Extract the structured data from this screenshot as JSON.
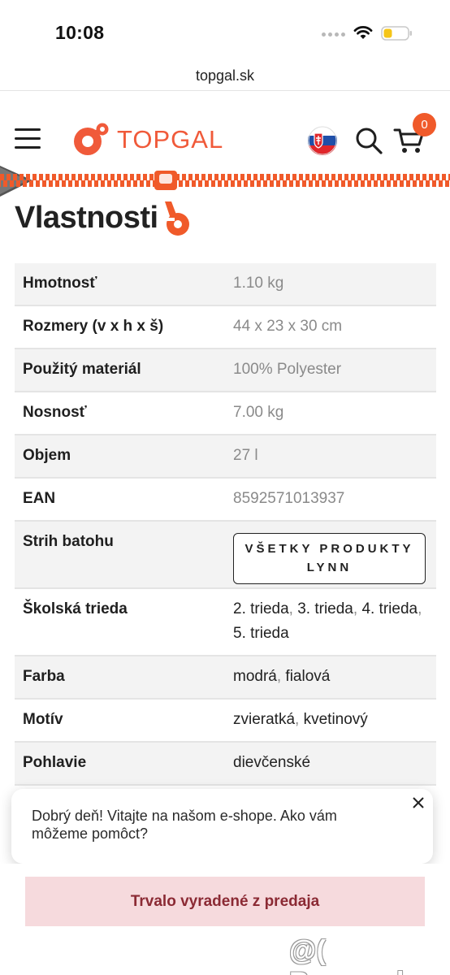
{
  "status_bar": {
    "time": "10:08"
  },
  "browser": {
    "url": "topgal.sk"
  },
  "header": {
    "logo_text": "TOPGAL",
    "cart_count": "0",
    "icons": [
      "menu-icon",
      "slovak-flag-icon",
      "search-icon",
      "cart-icon"
    ]
  },
  "section": {
    "title": "Vlastnosti"
  },
  "properties": [
    {
      "key": "Hmotnosť",
      "value": "1.10 kg"
    },
    {
      "key": "Rozmery (v x h x š)",
      "value": "44 x 23 x 30 cm"
    },
    {
      "key": "Použitý materiál",
      "value": "100% Polyester"
    },
    {
      "key": "Nosnosť",
      "value": "7.00 kg"
    },
    {
      "key": "Objem",
      "value": "27 l"
    },
    {
      "key": "EAN",
      "value": "8592571013937"
    },
    {
      "key": "Strih batohu",
      "button_label": "VŠETKY PRODUKTY LYNN"
    },
    {
      "key": "Školská trieda",
      "links": [
        "2. trieda",
        "3. trieda",
        "4. trieda",
        "5. trieda"
      ]
    },
    {
      "key": "Farba",
      "links": [
        "modrá",
        "fialová"
      ]
    },
    {
      "key": "Motív",
      "links": [
        "zvieratká",
        "kvetinový"
      ]
    },
    {
      "key": "Pohlavie",
      "links": [
        "dievčenské"
      ]
    }
  ],
  "chat": {
    "message": "Dobrý deň! Vitajte na našom e-shope. Ako vám môžeme pomôct?"
  },
  "status_notice": "Trvalo vyradené z predaja",
  "watermark": "@( Bazos.sk",
  "colors": {
    "brand": "#f05a3a",
    "notice_bg": "#f6dadd",
    "notice_text": "#8b2a34",
    "row_shade": "#f3f3f3"
  }
}
